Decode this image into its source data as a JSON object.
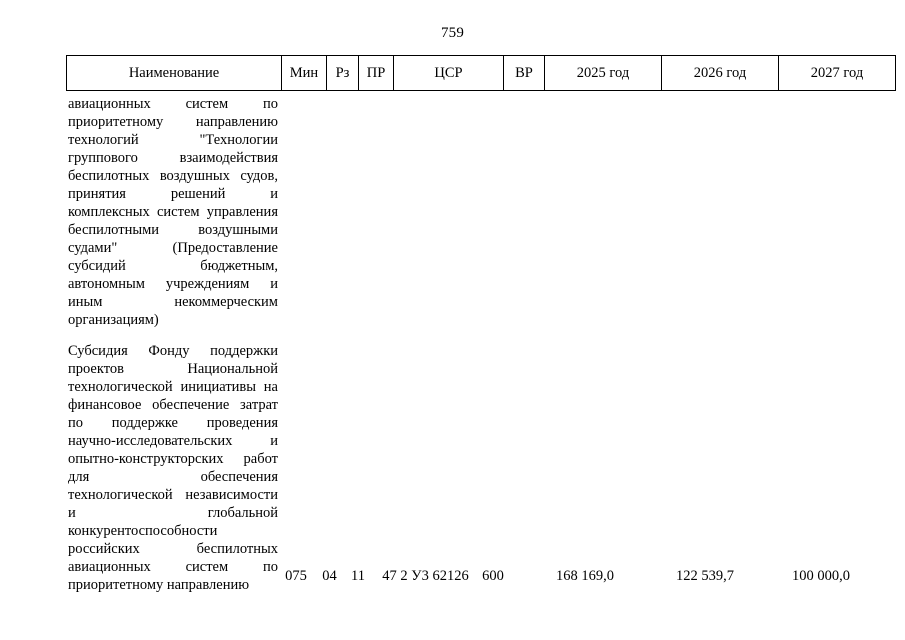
{
  "page": {
    "number": "759"
  },
  "table": {
    "headers": [
      {
        "key": "name",
        "label": "Наименование"
      },
      {
        "key": "min",
        "label": "Мин"
      },
      {
        "key": "rz",
        "label": "Рз"
      },
      {
        "key": "pr",
        "label": "ПР"
      },
      {
        "key": "csr",
        "label": "ЦСР"
      },
      {
        "key": "vr",
        "label": "ВР"
      },
      {
        "key": "y2025",
        "label": "2025 год"
      },
      {
        "key": "y2026",
        "label": "2026 год"
      },
      {
        "key": "y2027",
        "label": "2027 год"
      }
    ],
    "rows": [
      {
        "paragraphs": [
          "авиационных систем по приоритетному направлению технологий \"Технологии группового взаимодействия беспилотных воздушных судов, принятия решений и комплексных систем управления беспилотными воздушными судами\" (Предоставление субсидий бюджетным, автономным учреждениям и иным некоммерческим организациям)",
          "Субсидия Фонду поддержки проектов Национальной технологической инициативы на финансовое обеспечение затрат по поддержке проведения научно-исследовательских и опытно-конструкторских работ для обеспечения технологической независимости и глобальной конкурентоспособности российских беспилотных авиационных систем по приоритетному направлению"
        ],
        "min": "075",
        "rz": "04",
        "pr": "11",
        "csr": "47 2 У3 62126",
        "vr": "600",
        "y2025": "168 169,0",
        "y2026": "122 539,7",
        "y2027": "100 000,0"
      }
    ]
  }
}
